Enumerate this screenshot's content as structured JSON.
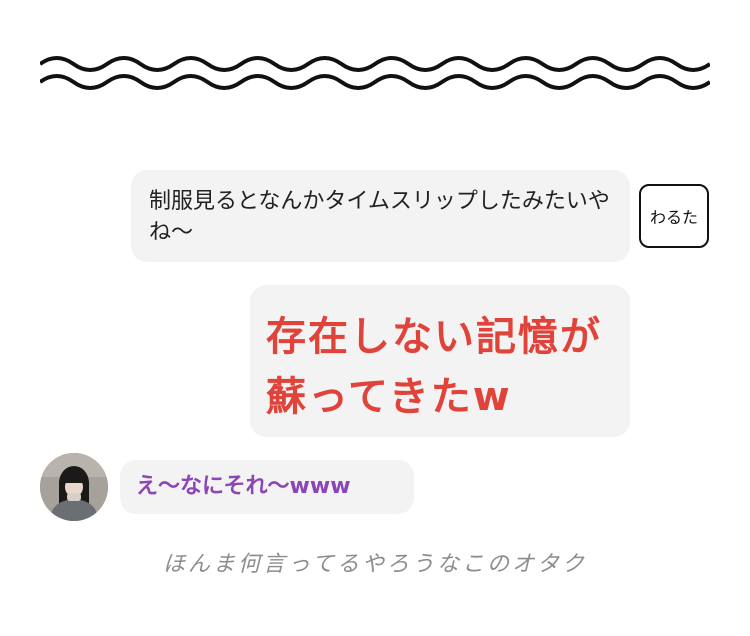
{
  "decoration": {
    "wave_icon": "wavy-double-line"
  },
  "messages": [
    {
      "text": "制服見るとなんかタイムスリップしたみたいやね〜",
      "sender_tag": "わるた",
      "color": "#222222"
    },
    {
      "text": "存在しない記憶が蘇ってきたw",
      "color": "#e0433a"
    },
    {
      "text": "え〜なにそれ〜www",
      "color": "#8b45b6",
      "avatar_icon": "user-photo-avatar"
    }
  ],
  "caption": "ほんま何言ってるやろうなこのオタク"
}
